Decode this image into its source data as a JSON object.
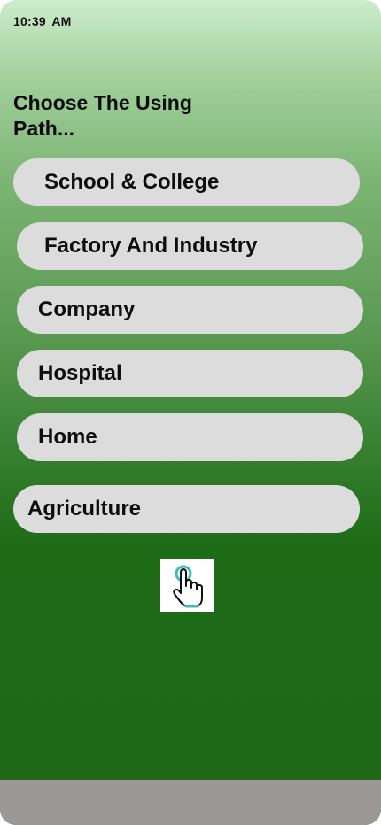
{
  "status": {
    "time": "10:39  AM"
  },
  "header": {
    "title": "Choose The Using Path..."
  },
  "options": [
    {
      "label": "School & College"
    },
    {
      "label": "Factory And Industry"
    },
    {
      "label": "Company"
    },
    {
      "label": "Hospital"
    },
    {
      "label": "Home"
    },
    {
      "label": "Agriculture"
    }
  ],
  "icons": {
    "tap": "tap-hand-icon"
  },
  "colors": {
    "button_bg": "#dcdcdc",
    "background_top": "#cdeccb",
    "background_bottom": "#1e6818",
    "bottom_bar": "#9b9897",
    "icon_accent": "#3bbfb8"
  }
}
